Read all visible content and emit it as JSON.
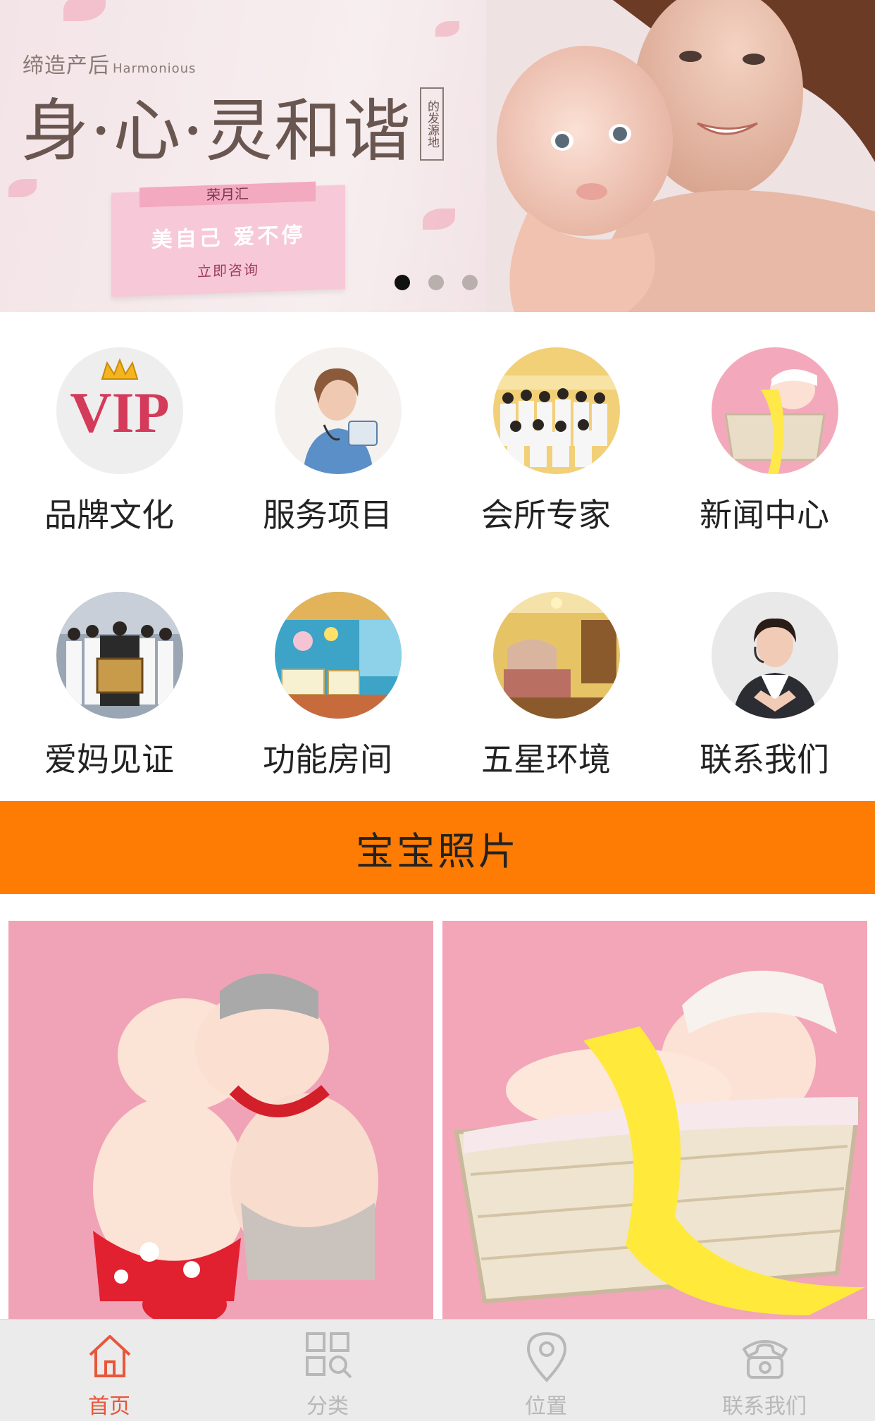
{
  "banner": {
    "kicker": "缔造产后",
    "kicker_en": "Harmonious",
    "title": "身·心·灵和谐",
    "vertical_text": "的发源地",
    "card_top": "荣月汇",
    "card_main": "美自己 爱不停",
    "card_sub": "立即咨询",
    "slides": 3,
    "active_slide": 1
  },
  "menu": {
    "items": [
      {
        "label": "品牌文化",
        "icon": "vip-crown-icon"
      },
      {
        "label": "服务项目",
        "icon": "nurse-photo"
      },
      {
        "label": "会所专家",
        "icon": "staff-group-photo"
      },
      {
        "label": "新闻中心",
        "icon": "baby-basket-photo"
      },
      {
        "label": "爱妈见证",
        "icon": "certificate-photo"
      },
      {
        "label": "功能房间",
        "icon": "baby-room-photo"
      },
      {
        "label": "五星环境",
        "icon": "bedroom-photo"
      },
      {
        "label": "联系我们",
        "icon": "customer-service-photo"
      }
    ]
  },
  "section": {
    "title": "宝宝照片"
  },
  "tabbar": {
    "tabs": [
      {
        "label": "首页",
        "icon": "home-icon",
        "active": true
      },
      {
        "label": "分类",
        "icon": "category-icon",
        "active": false
      },
      {
        "label": "位置",
        "icon": "location-pin-icon",
        "active": false
      },
      {
        "label": "联系我们",
        "icon": "telephone-icon",
        "active": false
      }
    ]
  },
  "colors": {
    "accent": "#ff7c04",
    "active_tab": "#e8563a",
    "inactive_tab": "#b8b8b8"
  }
}
